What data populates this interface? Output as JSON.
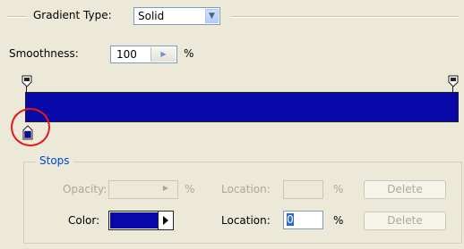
{
  "gradient_type": {
    "label": "Gradient Type:",
    "value": "Solid"
  },
  "smoothness": {
    "label": "Smoothness:",
    "value": "100",
    "unit": "%"
  },
  "gradient": {
    "color": "#0808a8"
  },
  "stops": {
    "title": "Stops",
    "opacity": {
      "label": "Opacity:",
      "unit": "%"
    },
    "opacity_location": {
      "label": "Location:",
      "unit": "%"
    },
    "opacity_delete": "Delete",
    "color": {
      "label": "Color:",
      "value": "#0808a8"
    },
    "color_location": {
      "label": "Location:",
      "value": "0",
      "unit": "%"
    },
    "color_delete": "Delete"
  },
  "annotation": {
    "color": "#e21a1a"
  }
}
